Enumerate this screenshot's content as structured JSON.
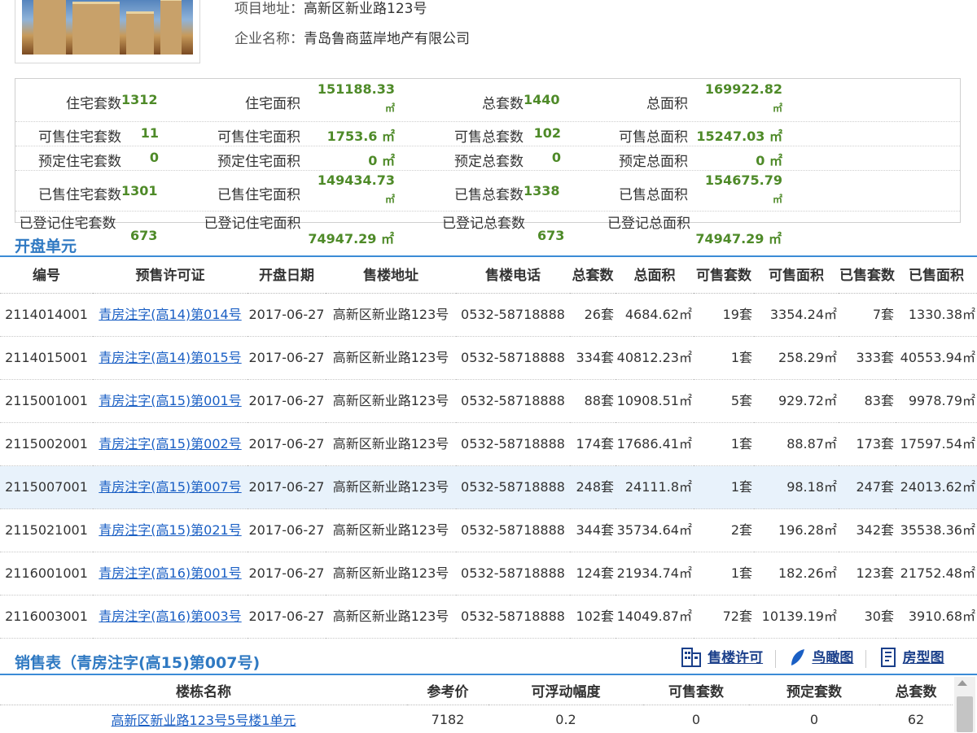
{
  "project": {
    "address_label": "项目地址：",
    "address": "高新区新业路123号",
    "company_label": "企业名称：",
    "company": "青岛鲁商蓝岸地产有限公司"
  },
  "stats": {
    "rows": [
      [
        {
          "label": "住宅套数",
          "value": "1312"
        },
        {
          "label": "住宅面积",
          "value": "151188.33",
          "unit": "㎡"
        },
        {
          "label": "总套数",
          "value": "1440"
        },
        {
          "label": "总面积",
          "value": "169922.82",
          "unit": "㎡"
        }
      ],
      [
        {
          "label": "可售住宅套数",
          "value": "11"
        },
        {
          "label": "可售住宅面积",
          "value": "1753.6 ㎡"
        },
        {
          "label": "可售总套数",
          "value": "102"
        },
        {
          "label": "可售总面积",
          "value": "15247.03 ㎡"
        }
      ],
      [
        {
          "label": "预定住宅套数",
          "value": "0"
        },
        {
          "label": "预定住宅面积",
          "value": "0 ㎡"
        },
        {
          "label": "预定总套数",
          "value": "0"
        },
        {
          "label": "预定总面积",
          "value": "0 ㎡"
        }
      ],
      [
        {
          "label": "已售住宅套数",
          "value": "1301"
        },
        {
          "label": "已售住宅面积",
          "value": "149434.73",
          "unit": "㎡"
        },
        {
          "label": "已售总套数",
          "value": "1338"
        },
        {
          "label": "已售总面积",
          "value": "154675.79",
          "unit": "㎡"
        }
      ],
      [
        {
          "label": "已登记住宅套数",
          "value": "673"
        },
        {
          "label": "已登记住宅面积",
          "value": "74947.29 ㎡"
        },
        {
          "label": "已登记总套数",
          "value": "673"
        },
        {
          "label": "已登记总面积",
          "value": "74947.29 ㎡"
        }
      ]
    ]
  },
  "units_section": {
    "title": "开盘单元",
    "headers": [
      "编号",
      "预售许可证",
      "开盘日期",
      "售楼地址",
      "售楼电话",
      "总套数",
      "总面积",
      "可售套数",
      "可售面积",
      "已售套数",
      "已售面积"
    ],
    "rows": [
      [
        "2114014001",
        "青房注字(高14)第014号",
        "2017-06-27",
        "高新区新业路123号",
        "0532-58718888",
        "26套",
        "4684.62㎡",
        "19套",
        "3354.24㎡",
        "7套",
        "1330.38㎡"
      ],
      [
        "2114015001",
        "青房注字(高14)第015号",
        "2017-06-27",
        "高新区新业路123号",
        "0532-58718888",
        "334套",
        "40812.23㎡",
        "1套",
        "258.29㎡",
        "333套",
        "40553.94㎡"
      ],
      [
        "2115001001",
        "青房注字(高15)第001号",
        "2017-06-27",
        "高新区新业路123号",
        "0532-58718888",
        "88套",
        "10908.51㎡",
        "5套",
        "929.72㎡",
        "83套",
        "9978.79㎡"
      ],
      [
        "2115002001",
        "青房注字(高15)第002号",
        "2017-06-27",
        "高新区新业路123号",
        "0532-58718888",
        "174套",
        "17686.41㎡",
        "1套",
        "88.87㎡",
        "173套",
        "17597.54㎡"
      ],
      [
        "2115007001",
        "青房注字(高15)第007号",
        "2017-06-27",
        "高新区新业路123号",
        "0532-58718888",
        "248套",
        "24111.8㎡",
        "1套",
        "98.18㎡",
        "247套",
        "24013.62㎡"
      ],
      [
        "2115021001",
        "青房注字(高15)第021号",
        "2017-06-27",
        "高新区新业路123号",
        "0532-58718888",
        "344套",
        "35734.64㎡",
        "2套",
        "196.28㎡",
        "342套",
        "35538.36㎡"
      ],
      [
        "2116001001",
        "青房注字(高16)第001号",
        "2017-06-27",
        "高新区新业路123号",
        "0532-58718888",
        "124套",
        "21934.74㎡",
        "1套",
        "182.26㎡",
        "123套",
        "21752.48㎡"
      ],
      [
        "2116003001",
        "青房注字(高16)第003号",
        "2017-06-27",
        "高新区新业路123号",
        "0532-58718888",
        "102套",
        "14049.87㎡",
        "72套",
        "10139.19㎡",
        "30套",
        "3910.68㎡"
      ]
    ],
    "highlighted_row": 4
  },
  "sales_section": {
    "title": "销售表（青房注字(高15)第007号)",
    "links": {
      "permit": "售楼许可",
      "aerial": "鸟瞰图",
      "floorplan": "房型图"
    },
    "headers": [
      "楼栋名称",
      "参考价",
      "可浮动幅度",
      "可售套数",
      "预定套数",
      "总套数"
    ],
    "rows": [
      [
        "高新区新业路123号5号楼1单元",
        "7182",
        "0.2",
        "0",
        "0",
        "62"
      ]
    ]
  },
  "colors": {
    "accent": "#2f79c2",
    "value_green": "#4e8a28",
    "link": "#1a5fc4",
    "highlight_row": "#e8f2fb"
  }
}
